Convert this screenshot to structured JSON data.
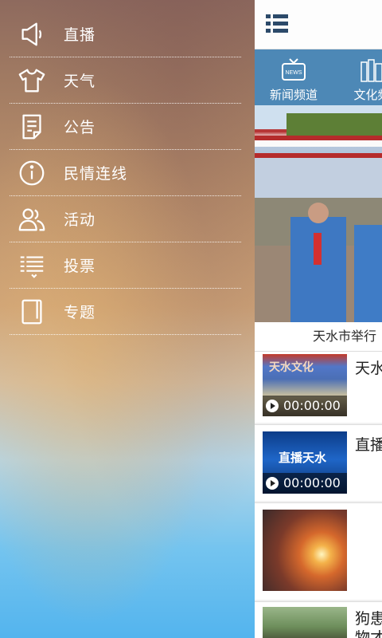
{
  "drawer": {
    "items": [
      {
        "label": "直播",
        "icon": "megaphone-icon"
      },
      {
        "label": "天气",
        "icon": "tshirt-icon"
      },
      {
        "label": "公告",
        "icon": "notice-icon"
      },
      {
        "label": "民情连线",
        "icon": "info-icon"
      },
      {
        "label": "活动",
        "icon": "people-icon"
      },
      {
        "label": "投票",
        "icon": "vote-list-icon"
      },
      {
        "label": "专题",
        "icon": "book-icon"
      }
    ]
  },
  "content": {
    "channels": [
      {
        "label": "新闻频道",
        "icon": "tv-news-icon",
        "badge": "NEWS"
      },
      {
        "label": "文化频",
        "icon": "books-icon"
      }
    ],
    "hero_caption": "天水市举行",
    "cards": [
      {
        "title": "天水",
        "time": "00:00:00",
        "thumb_text": "天水文化"
      },
      {
        "title": "直播",
        "time": "00:00:00",
        "thumb_text": "直播天水"
      },
      {
        "title": "",
        "time": ""
      },
      {
        "title": "狗患",
        "title2": "物才",
        "time": ""
      }
    ]
  }
}
